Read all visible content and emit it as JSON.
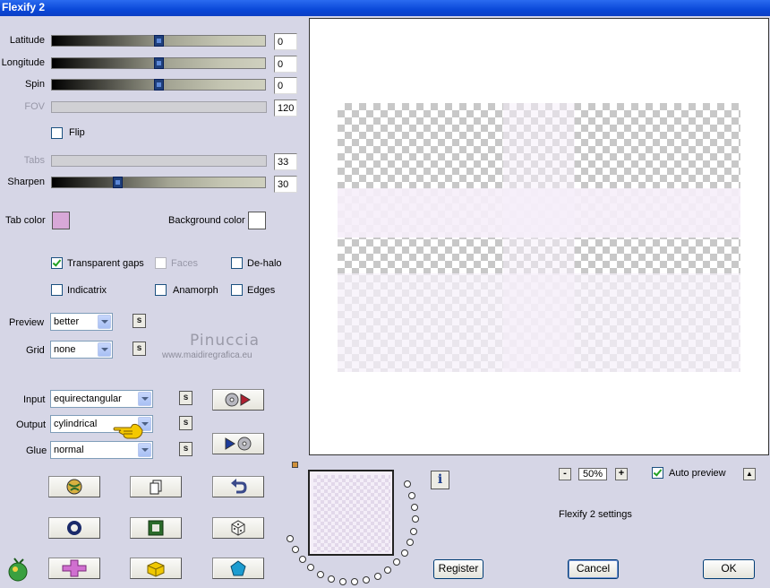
{
  "window": {
    "title": "Flexify 2"
  },
  "sliders": {
    "latitude": {
      "label": "Latitude",
      "value": "0",
      "position": 0.5
    },
    "longitude": {
      "label": "Longitude",
      "value": "0",
      "position": 0.5
    },
    "spin": {
      "label": "Spin",
      "value": "0",
      "position": 0.5
    },
    "fov": {
      "label": "FOV",
      "value": "120",
      "enabled": false
    },
    "tabs": {
      "label": "Tabs",
      "value": "33",
      "enabled": false
    },
    "sharpen": {
      "label": "Sharpen",
      "value": "30",
      "position": 0.3
    }
  },
  "flip": {
    "label": "Flip",
    "checked": false
  },
  "colors": {
    "tab_color_label": "Tab color",
    "tab_color": "#d8a8d8",
    "background_color_label": "Background color",
    "background_color": "#ffffff"
  },
  "options": {
    "transparent_gaps": {
      "label": "Transparent gaps",
      "checked": true
    },
    "faces": {
      "label": "Faces",
      "checked": false,
      "enabled": false
    },
    "de_halo": {
      "label": "De-halo",
      "checked": false
    },
    "indicatrix": {
      "label": "Indicatrix",
      "checked": false
    },
    "anamorph": {
      "label": "Anamorph",
      "checked": false
    },
    "edges": {
      "label": "Edges",
      "checked": false
    }
  },
  "selects": {
    "preview": {
      "label": "Preview",
      "value": "better"
    },
    "grid": {
      "label": "Grid",
      "value": "none"
    },
    "input": {
      "label": "Input",
      "value": "equirectangular"
    },
    "output": {
      "label": "Output",
      "value": "cylindrical"
    },
    "glue": {
      "label": "Glue",
      "value": "normal"
    }
  },
  "s_label": "s",
  "watermark": {
    "line1": "Pinuccia",
    "line2": "www.maidiregrafica.eu"
  },
  "zoom": {
    "minus": "-",
    "value": "50%",
    "plus": "+"
  },
  "auto_preview": {
    "label": "Auto preview",
    "checked": true
  },
  "up_button": "▲",
  "settings_label": "Flexify 2 settings",
  "info_button": "i",
  "buttons": {
    "register": "Register",
    "cancel": "Cancel",
    "ok": "OK"
  },
  "colors_ui": {
    "accent": "#0a48d8",
    "panel": "#d6d6e6"
  }
}
